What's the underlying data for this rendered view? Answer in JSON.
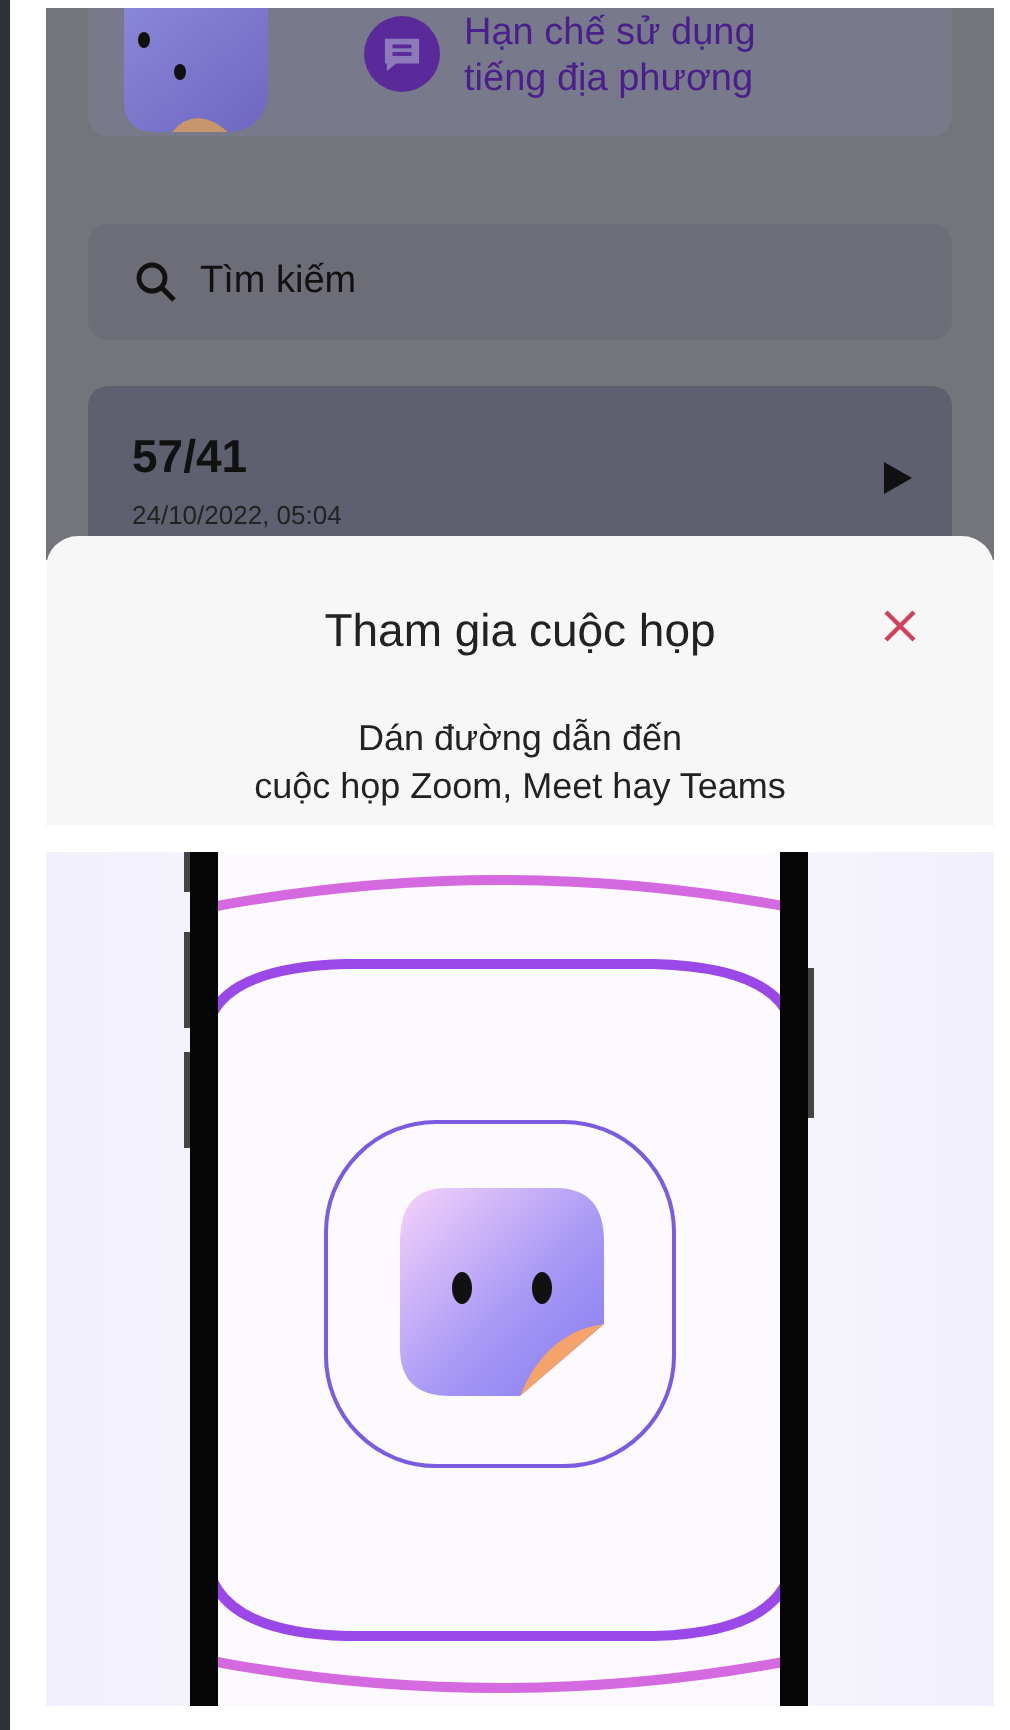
{
  "background_page": {
    "banner": {
      "lines": [
        "Hạn chế sử dụng",
        "tiếng địa phương"
      ]
    },
    "search": {
      "placeholder": "Tìm kiếm"
    },
    "recordings": [
      {
        "title": "57/41",
        "date": "24/10/2022, 05:04"
      }
    ]
  },
  "sheet": {
    "title": "Tham gia cuộc họp",
    "description_lines": [
      "Dán đường dẫn đến",
      "cuộc họp Zoom, Meet hay Teams"
    ]
  }
}
